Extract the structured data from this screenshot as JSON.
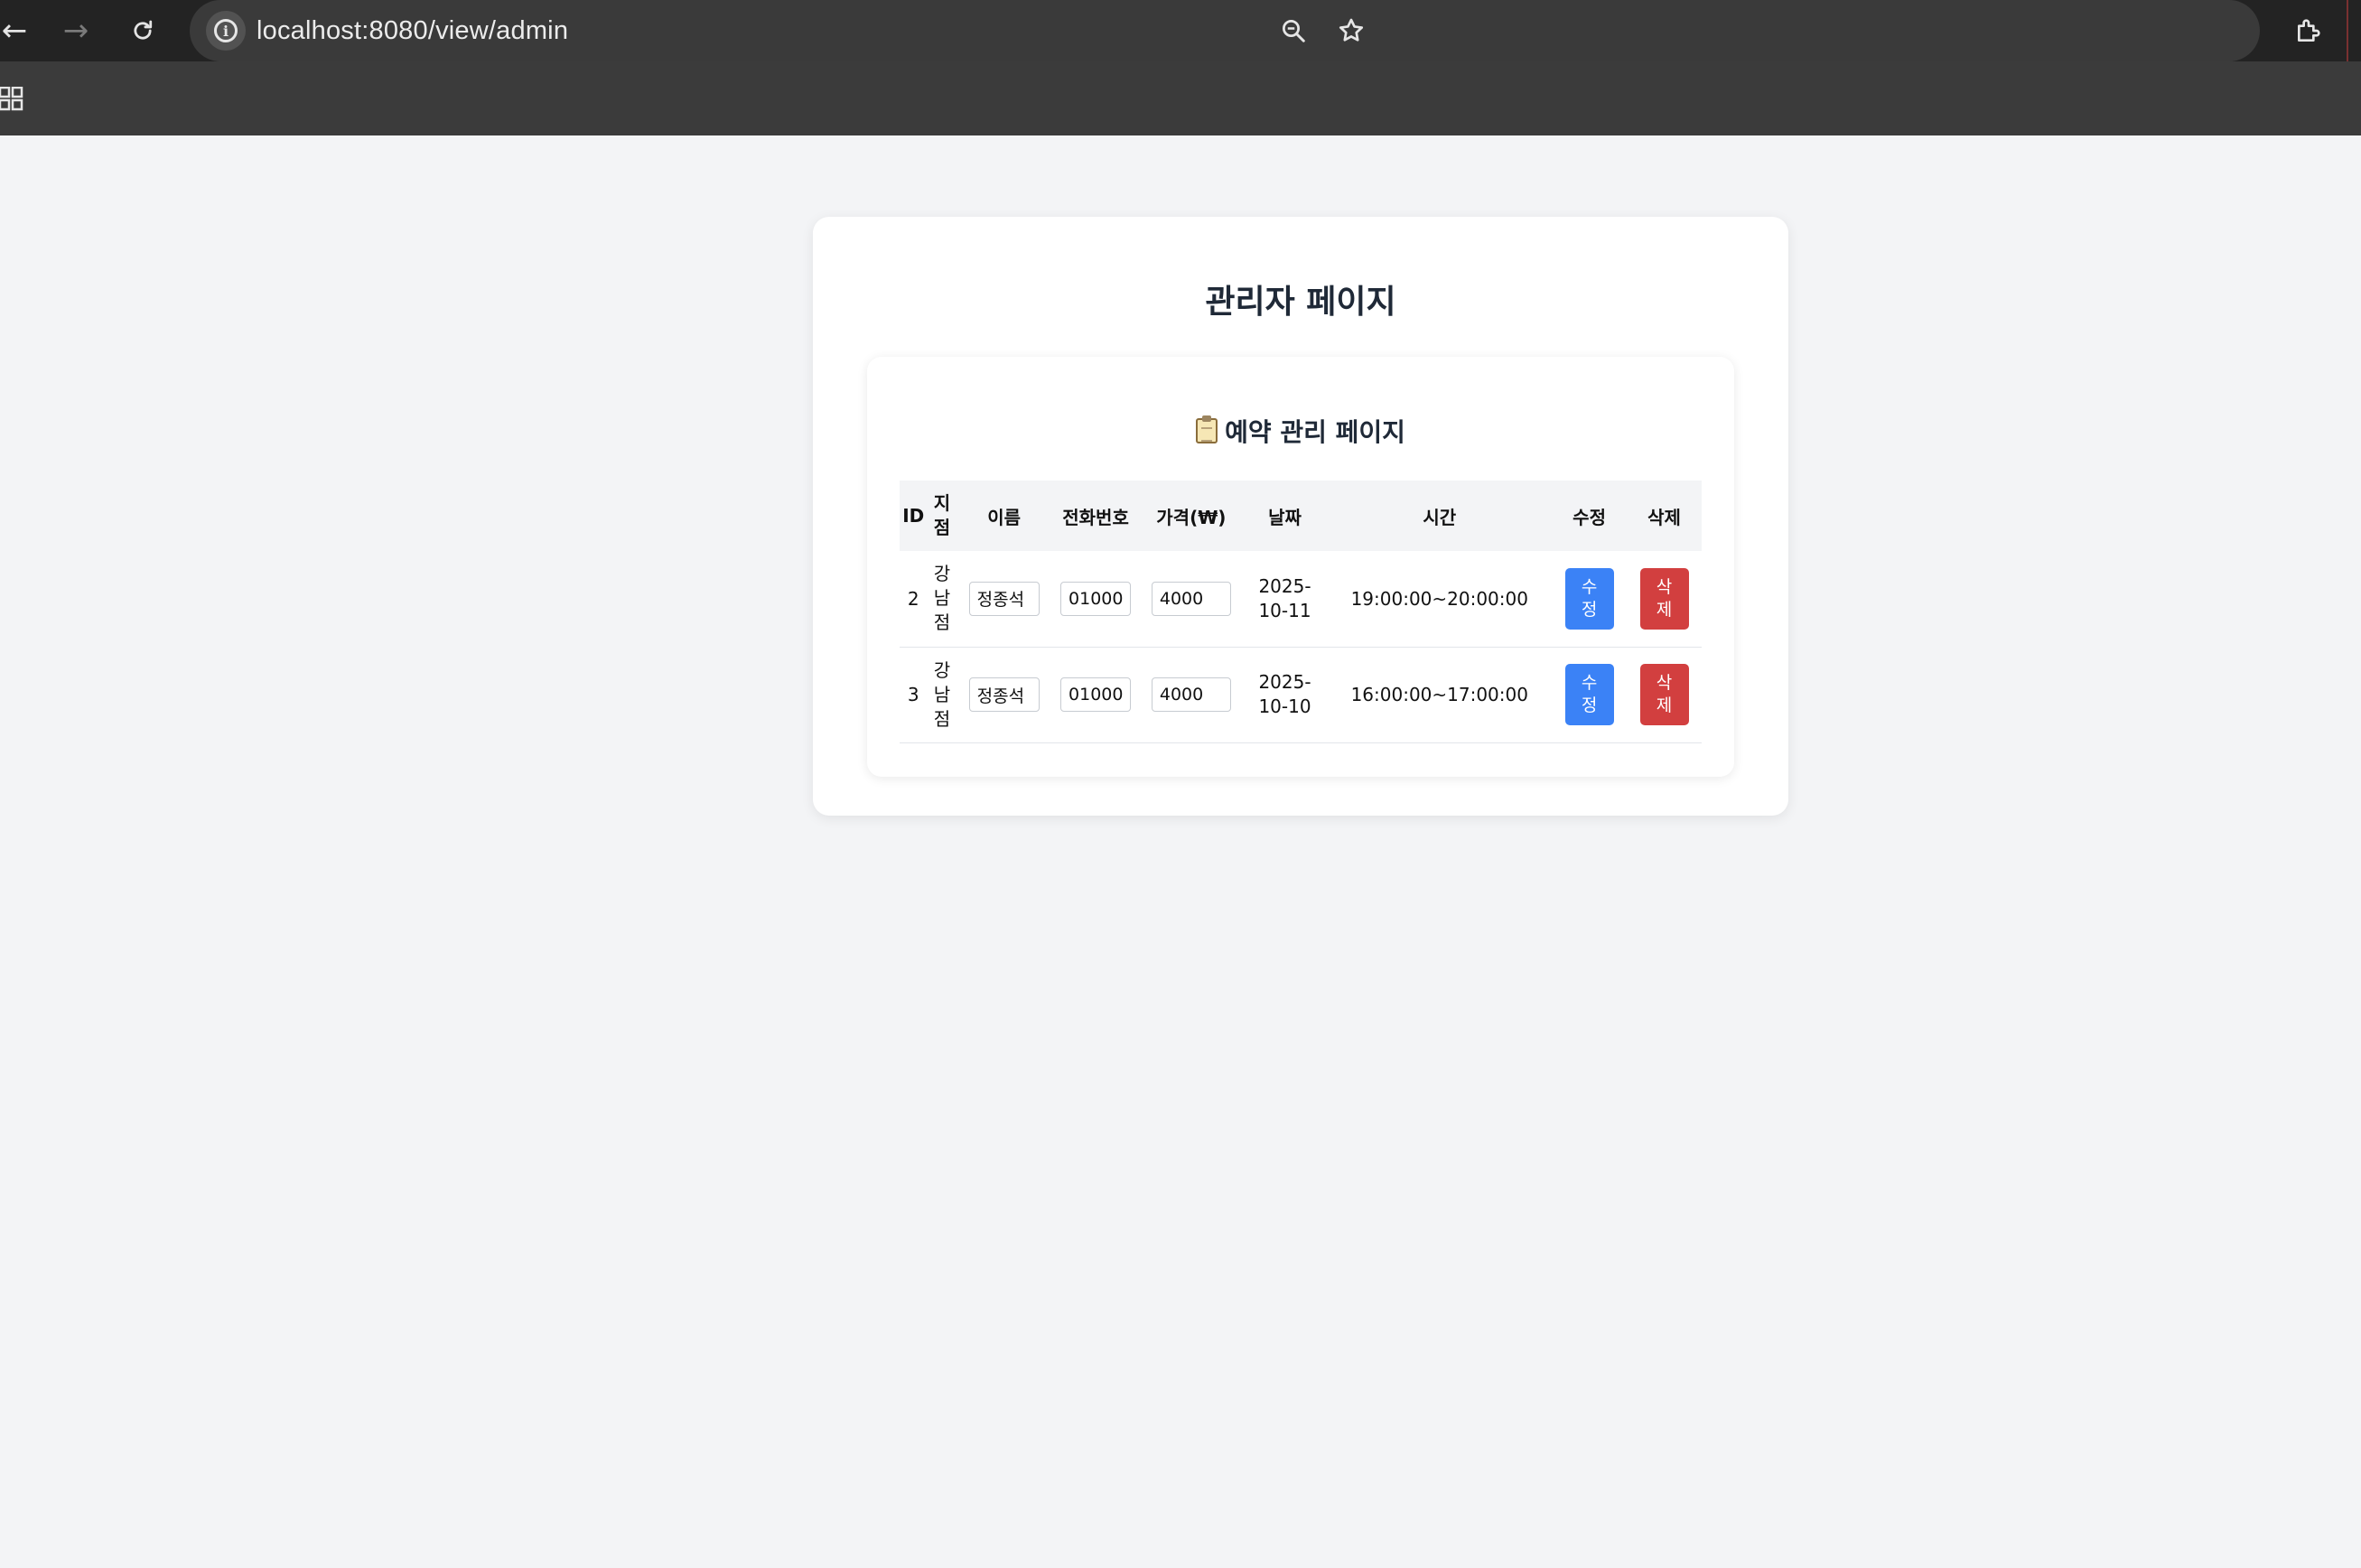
{
  "browser": {
    "url": "localhost:8080/view/admin",
    "icons": [
      "back-arrow-icon",
      "forward-arrow-icon",
      "reload-icon",
      "site-info-icon",
      "zoom-icon",
      "bookmark-star-icon",
      "extensions-icon",
      "apps-grid-icon"
    ]
  },
  "page": {
    "title": "관리자 페이지",
    "section_title": "예약 관리 페이지",
    "columns": [
      "ID",
      "지점",
      "이름",
      "전화번호",
      "가격(₩)",
      "날짜",
      "시간",
      "수정",
      "삭제"
    ],
    "rows": [
      {
        "id": "2",
        "branch": "강남점",
        "name": "정종석",
        "phone": "01000",
        "price": "4000",
        "date": "2025-10-11",
        "time": "19:00:00~20:00:00",
        "edit_label": "수정",
        "delete_label": "삭제"
      },
      {
        "id": "3",
        "branch": "강남점",
        "name": "정종석",
        "phone": "01000",
        "price": "4000",
        "date": "2025-10-10",
        "time": "16:00:00~17:00:00",
        "edit_label": "수정",
        "delete_label": "삭제"
      }
    ],
    "colors": {
      "edit": "#3b82f6",
      "delete": "#d23f3f",
      "background": "#f3f4f6"
    }
  }
}
